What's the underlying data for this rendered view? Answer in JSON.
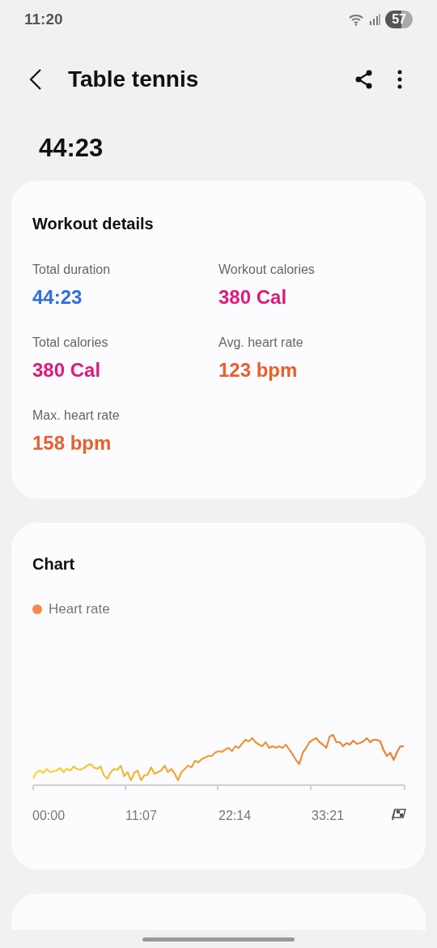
{
  "status_bar": {
    "time": "11:20",
    "battery": "57"
  },
  "header": {
    "title": "Table tennis"
  },
  "duration": "44:23",
  "workout_details": {
    "title": "Workout details",
    "stats": [
      {
        "label": "Total duration",
        "value": "44:23",
        "color": "#2f6fe0"
      },
      {
        "label": "Workout calories",
        "value": "380 Cal",
        "color": "#e0197d"
      },
      {
        "label": "Total calories",
        "value": "380 Cal",
        "color": "#e0197d"
      },
      {
        "label": "Avg. heart rate",
        "value": "123 bpm",
        "color": "#e8602c"
      },
      {
        "label": "Max. heart rate",
        "value": "158 bpm",
        "color": "#e8602c"
      }
    ]
  },
  "chart": {
    "title": "Chart",
    "legend": {
      "label": "Heart rate",
      "color": "#f5884a"
    },
    "x_labels": [
      "00:00",
      "11:07",
      "22:14",
      "33:21"
    ]
  }
}
